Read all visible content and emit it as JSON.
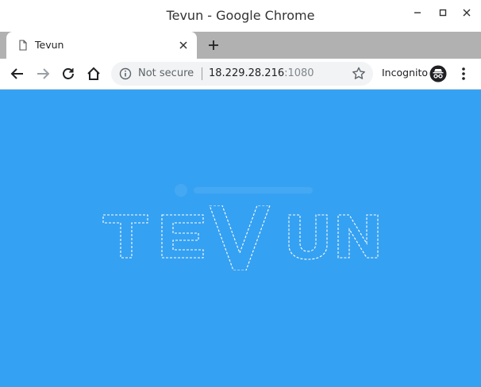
{
  "window": {
    "title": "Tevun - Google Chrome",
    "minimize_label": "–",
    "maximize_label": "□",
    "close_label": "✕"
  },
  "tab": {
    "title": "Tevun",
    "close_label": "×"
  },
  "newtab_label": "+",
  "omnibox": {
    "security_label": "Not secure",
    "host": "18.229.28.216",
    "port": ":1080"
  },
  "incognito_label": "Incognito",
  "page": {
    "logo_text": "TEVUN",
    "accent_color": "#35a1f2"
  }
}
